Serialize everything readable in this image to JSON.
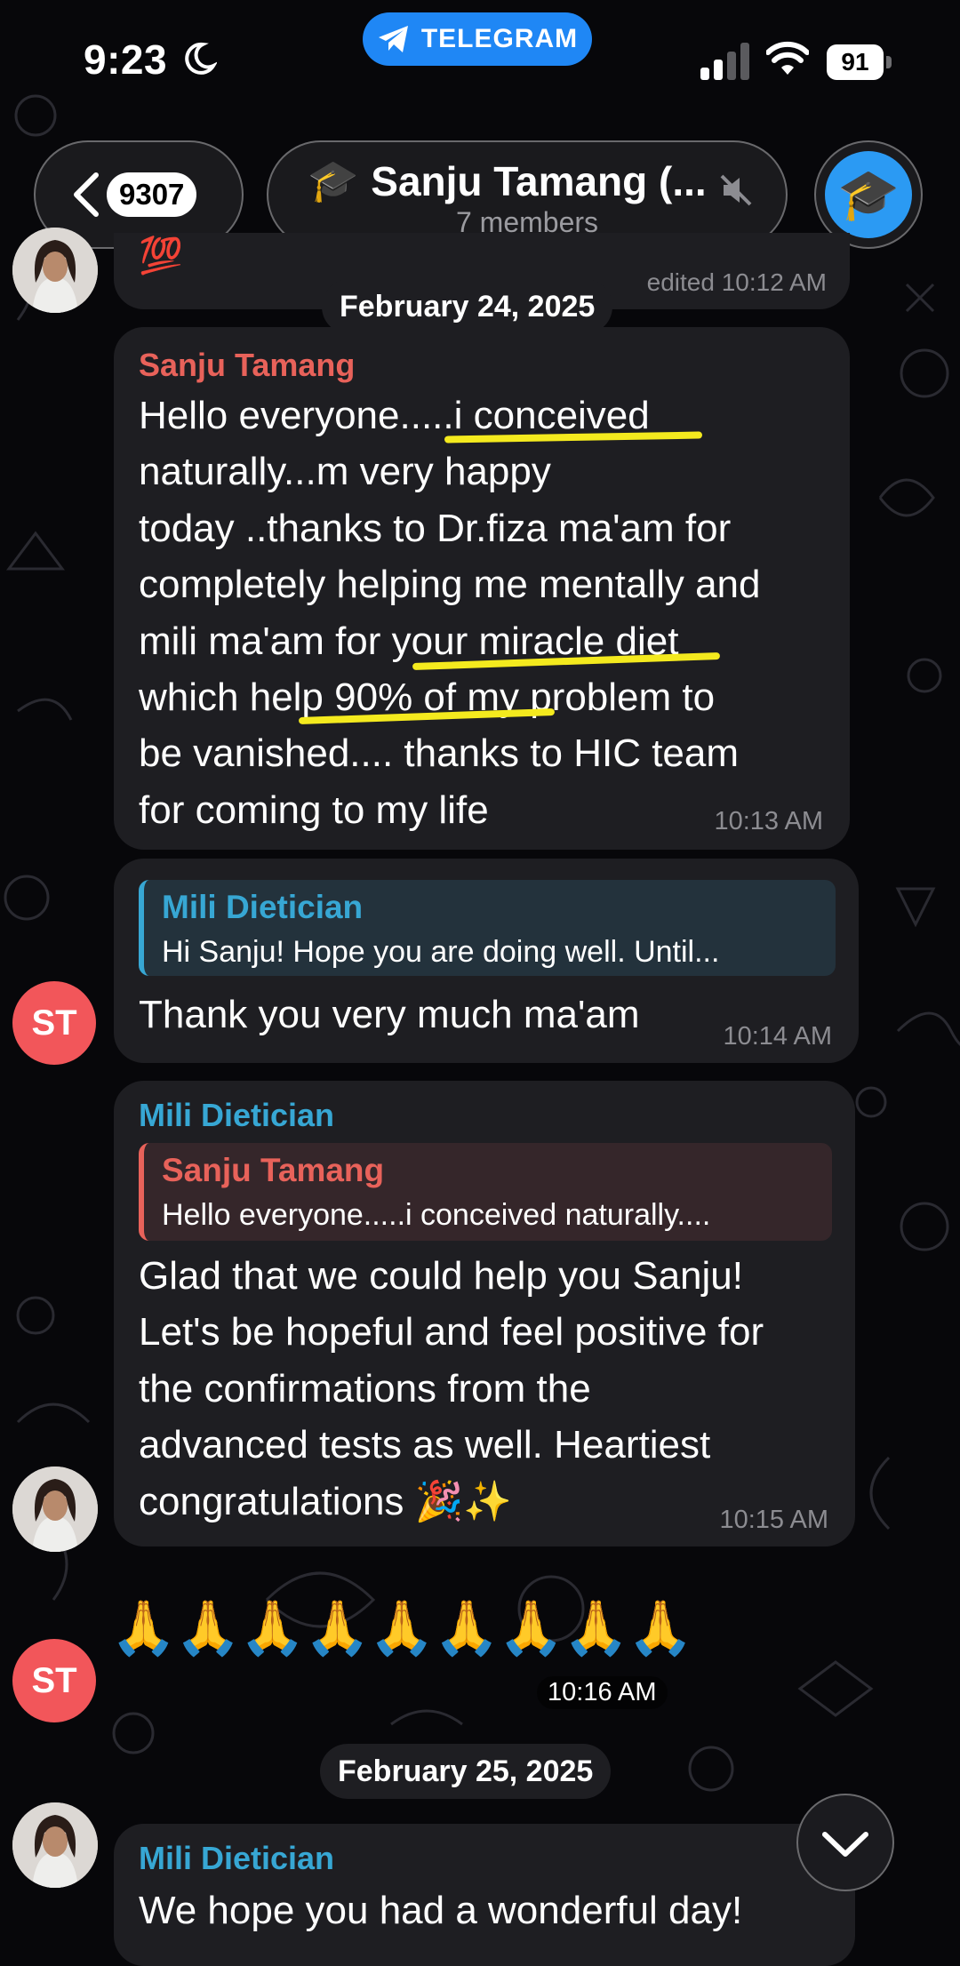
{
  "status_bar": {
    "time": "9:23",
    "battery": "91",
    "banner": "TELEGRAM"
  },
  "header": {
    "back_count": "9307",
    "title": "Sanju Tamang (...",
    "subtitle": "7 members",
    "title_icon": "🎓",
    "avatar_icon": "🎓"
  },
  "previous_message": {
    "emoji": "💯",
    "meta": "edited 10:12 AM"
  },
  "dates": {
    "first": "February 24, 2025",
    "second": "February 25, 2025"
  },
  "messages": [
    {
      "sender": "Sanju Tamang",
      "lines": [
        "Hello everyone.....i conceived",
        "naturally...m very happy",
        "today ..thanks to Dr.fiza ma'am for",
        "completely helping me mentally and",
        "mili ma'am for your miracle diet",
        "which help 90% of my problem to",
        "be vanished.... thanks to HIC team",
        "for coming to my life"
      ],
      "time": "10:13 AM"
    },
    {
      "reply_to": {
        "name": "Mili Dietician",
        "text": "Hi Sanju! Hope you are doing well. Until..."
      },
      "text": "Thank you very much ma'am",
      "time": "10:14 AM",
      "avatar": "ST"
    },
    {
      "sender": "Mili Dietician",
      "reply_to": {
        "name": "Sanju Tamang",
        "text": "Hello everyone.....i conceived naturally...."
      },
      "lines": [
        "Glad that we could help you Sanju!",
        "Let's be hopeful and feel positive for",
        "the confirmations from the",
        "advanced tests as well. Heartiest",
        "congratulations 🎉✨"
      ],
      "time": "10:15 AM"
    },
    {
      "emoji": "🙏🙏🙏🙏🙏🙏🙏🙏🙏",
      "time": "10:16 AM",
      "avatar": "ST"
    },
    {
      "sender": "Mili Dietician",
      "text": "We hope you had a wonderful day!"
    }
  ],
  "colors": {
    "sanju": "#e8625a",
    "mili": "#37a7d4",
    "bubble": "#1e1e22",
    "highlight": "#f4ea1e",
    "telegram": "#1f87f5"
  }
}
